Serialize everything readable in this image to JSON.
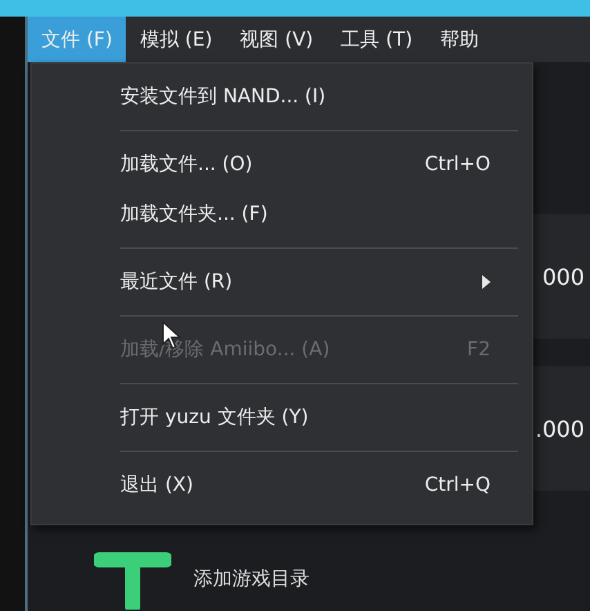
{
  "menu_bar": [
    {
      "label": "文件 (F)",
      "selected": true
    },
    {
      "label": "模拟 (E)",
      "selected": false
    },
    {
      "label": "视图 (V)",
      "selected": false
    },
    {
      "label": "工具 (T)",
      "selected": false
    },
    {
      "label": "帮助",
      "selected": false
    }
  ],
  "dropdown": [
    {
      "kind": "item",
      "label": "安装文件到 NAND... (I)",
      "disabled": false
    },
    {
      "kind": "separator"
    },
    {
      "kind": "item",
      "label": "加载文件... (O)",
      "shortcut": "Ctrl+O",
      "disabled": false
    },
    {
      "kind": "item",
      "label": "加载文件夹... (F)",
      "disabled": false
    },
    {
      "kind": "separator"
    },
    {
      "kind": "submenu",
      "label": "最近文件 (R)",
      "disabled": false
    },
    {
      "kind": "separator"
    },
    {
      "kind": "item",
      "label": "加载/移除 Amiibo... (A)",
      "shortcut": "F2",
      "disabled": true
    },
    {
      "kind": "separator"
    },
    {
      "kind": "item",
      "label": "打开 yuzu 文件夹 (Y)",
      "disabled": false
    },
    {
      "kind": "separator"
    },
    {
      "kind": "item",
      "label": "退出 (X)",
      "shortcut": "Ctrl+Q",
      "disabled": false
    }
  ],
  "background_cards": [
    {
      "value": "000"
    },
    {
      "value": ".000"
    }
  ],
  "add_game_dir": {
    "label": "添加游戏目录"
  }
}
